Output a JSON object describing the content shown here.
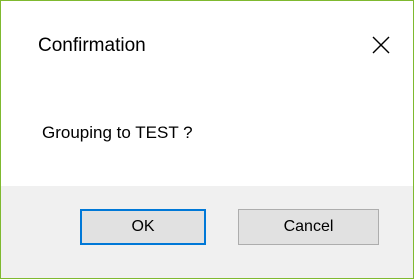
{
  "dialog": {
    "title": "Confirmation",
    "message": "Grouping to TEST ?",
    "buttons": {
      "ok_label": "OK",
      "cancel_label": "Cancel"
    }
  },
  "colors": {
    "window_border": "#7fb92f",
    "footer_background": "#f0f0f0",
    "button_background": "#e1e1e1",
    "default_button_focus": "#0078d7"
  },
  "icons": {
    "close": "close-icon"
  }
}
